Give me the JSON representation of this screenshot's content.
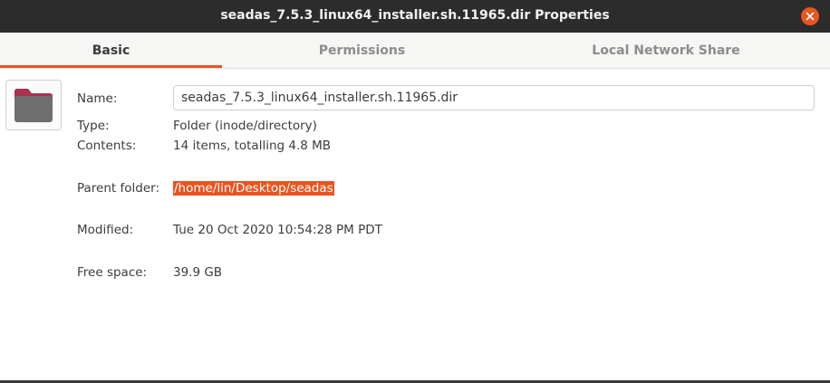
{
  "window": {
    "title": "seadas_7.5.3_linux64_installer.sh.11965.dir Properties"
  },
  "tabs": [
    {
      "label": "Basic",
      "active": true
    },
    {
      "label": "Permissions",
      "active": false
    },
    {
      "label": "Local Network Share",
      "active": false
    }
  ],
  "basic": {
    "name_label": "Name:",
    "name_value": "seadas_7.5.3_linux64_installer.sh.11965.dir",
    "type_label": "Type:",
    "type_value": "Folder (inode/directory)",
    "contents_label": "Contents:",
    "contents_value": "14 items, totalling 4.8 MB",
    "parent_label": "Parent folder:",
    "parent_value": "/home/lin/Desktop/seadas",
    "modified_label": "Modified:",
    "modified_value": "Tue 20 Oct 2020 10:54:28 PM PDT",
    "free_label": "Free space:",
    "free_value": "39.9 GB"
  },
  "icons": {
    "folder": "folder-icon",
    "close": "close-icon"
  },
  "colors": {
    "accent": "#e95420",
    "titlebar": "#2c2c2c",
    "folder_body": "#6e6e6e",
    "folder_tab": "#a9324f"
  }
}
